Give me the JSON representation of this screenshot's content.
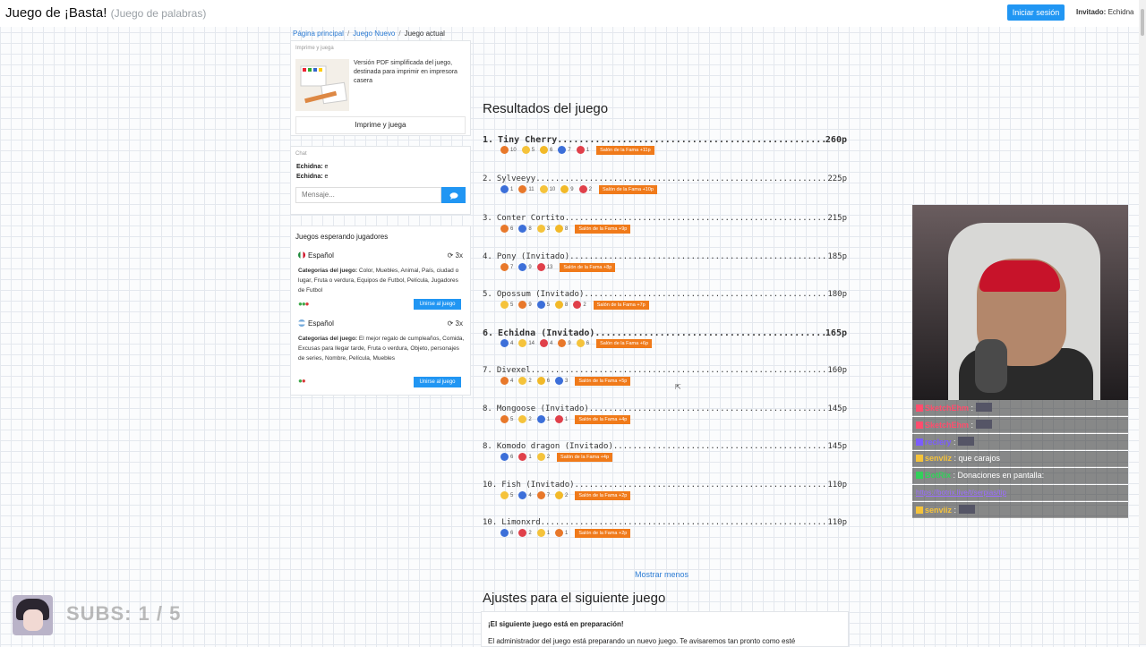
{
  "header": {
    "title": "Juego de ¡Basta!",
    "subtitle": "(Juego de palabras)",
    "login_label": "Iniciar sesión",
    "guest_label": "Invitado:",
    "guest_name": "Echidna"
  },
  "breadcrumb": {
    "home": "Página principal",
    "new_game": "Juego Nuevo",
    "current": "Juego actual"
  },
  "print": {
    "label": "Imprime y juega",
    "description": "Versión PDF simplificada del juego, destinada para imprimir en impresora casera",
    "button": "Imprime y juega"
  },
  "chat": {
    "label": "Chat",
    "messages": [
      {
        "user": "Echidna:",
        "text": "e"
      },
      {
        "user": "Echidna:",
        "text": "e"
      }
    ],
    "placeholder": "Mensaje..."
  },
  "waiting_games": {
    "title": "Juegos esperando jugadores",
    "games": [
      {
        "language": "Español",
        "multiplier": "3x",
        "cats_label": "Categorías del juego:",
        "cats": "Color, Muebles, Animal, País, ciudad o lugar, Fruta o verdura, Equipos de Futbol, Película, Jugadores de Futbol",
        "join": "Unirse al juego",
        "flag_color": "#2e8b3e"
      },
      {
        "language": "Español",
        "multiplier": "3x",
        "cats_label": "Categorías del juego:",
        "cats": "El mejor regalo de cumpleaños, Comida, Excusas para llegar tarde, Fruta o verdura, Objeto, personajes de series, Nombre, Película, Muebles",
        "join": "Unirse al juego",
        "flag_color": "#5aa0e0"
      }
    ]
  },
  "results": {
    "title": "Resultados del juego",
    "rows": [
      {
        "rank": "1.",
        "name": "Tiny Cherry",
        "points": "260p",
        "bold": true,
        "reactions": [
          {
            "type": "angry",
            "count": "10"
          },
          {
            "type": "laugh",
            "count": "5"
          },
          {
            "type": "wow",
            "count": "6"
          },
          {
            "type": "like",
            "count": "7"
          },
          {
            "type": "heart",
            "count": "1"
          }
        ],
        "fame": "Salón de la Fama +11p"
      },
      {
        "rank": "2.",
        "name": "Sylveeyy",
        "points": "225p",
        "bold": false,
        "reactions": [
          {
            "type": "like",
            "count": "1"
          },
          {
            "type": "angry",
            "count": "11"
          },
          {
            "type": "laugh",
            "count": "10"
          },
          {
            "type": "wow",
            "count": "9"
          },
          {
            "type": "heart",
            "count": "2"
          }
        ],
        "fame": "Salón de la Fama +10p"
      },
      {
        "rank": "3.",
        "name": "Conter Cortito",
        "points": "215p",
        "bold": false,
        "reactions": [
          {
            "type": "angry",
            "count": "6"
          },
          {
            "type": "like",
            "count": "8"
          },
          {
            "type": "laugh",
            "count": "3"
          },
          {
            "type": "wow",
            "count": "8"
          }
        ],
        "fame": "Salón de la Fama +9p"
      },
      {
        "rank": "4.",
        "name": "Pony (Invitado)",
        "points": "185p",
        "bold": false,
        "reactions": [
          {
            "type": "angry",
            "count": "7"
          },
          {
            "type": "like",
            "count": "9"
          },
          {
            "type": "heart",
            "count": "13"
          }
        ],
        "fame": "Salón de la Fama +8p"
      },
      {
        "rank": "5.",
        "name": "Opossum (Invitado)",
        "points": "180p",
        "bold": false,
        "reactions": [
          {
            "type": "laugh",
            "count": "5"
          },
          {
            "type": "angry",
            "count": "9"
          },
          {
            "type": "like",
            "count": "5"
          },
          {
            "type": "wow",
            "count": "8"
          },
          {
            "type": "heart",
            "count": "2"
          }
        ],
        "fame": "Salón de la Fama +7p"
      },
      {
        "rank": "6.",
        "name": "Echidna (Invitado)",
        "points": "165p",
        "bold": true,
        "reactions": [
          {
            "type": "like",
            "count": "4"
          },
          {
            "type": "laugh",
            "count": "14"
          },
          {
            "type": "heart",
            "count": "4"
          },
          {
            "type": "angry",
            "count": "9"
          },
          {
            "type": "laugh",
            "count": "6"
          }
        ],
        "fame": "Salón de la Fama +6p"
      },
      {
        "rank": "7.",
        "name": "Divexel",
        "points": "160p",
        "bold": false,
        "reactions": [
          {
            "type": "angry",
            "count": "4"
          },
          {
            "type": "laugh",
            "count": "2"
          },
          {
            "type": "wow",
            "count": "6"
          },
          {
            "type": "like",
            "count": "3"
          }
        ],
        "fame": "Salón de la Fama +5p"
      },
      {
        "rank": "8.",
        "name": "Mongoose (Invitado)",
        "points": "145p",
        "bold": false,
        "reactions": [
          {
            "type": "angry",
            "count": "5"
          },
          {
            "type": "laugh",
            "count": "2"
          },
          {
            "type": "like",
            "count": "1"
          },
          {
            "type": "heart",
            "count": "1"
          }
        ],
        "fame": "Salón de la Fama +4p"
      },
      {
        "rank": "8.",
        "name": "Komodo dragon (Invitado)",
        "points": "145p",
        "bold": false,
        "reactions": [
          {
            "type": "like",
            "count": "6"
          },
          {
            "type": "heart",
            "count": "1"
          },
          {
            "type": "laugh",
            "count": "2"
          }
        ],
        "fame": "Salón de la Fama +4p"
      },
      {
        "rank": "10.",
        "name": "Fish (Invitado)",
        "points": "110p",
        "bold": false,
        "reactions": [
          {
            "type": "laugh",
            "count": "5"
          },
          {
            "type": "like",
            "count": "4"
          },
          {
            "type": "angry",
            "count": "7"
          },
          {
            "type": "wow",
            "count": "2"
          }
        ],
        "fame": "Salón de la Fama +2p"
      },
      {
        "rank": "10.",
        "name": "Limonxrd",
        "points": "110p",
        "bold": false,
        "reactions": [
          {
            "type": "like",
            "count": "6"
          },
          {
            "type": "heart",
            "count": "2"
          },
          {
            "type": "laugh",
            "count": "1"
          },
          {
            "type": "angry",
            "count": "1"
          }
        ],
        "fame": "Salón de la Fama +2p"
      }
    ],
    "show_less": "Mostrar menos"
  },
  "settings": {
    "title": "Ajustes para el siguiente juego",
    "heading": "¡El siguiente juego está en preparación!",
    "body": "El administrador del juego está preparando un nuevo juego. Te avisaremos tan pronto como esté"
  },
  "stream_chat": {
    "lines": [
      {
        "user": "SketchEhm",
        "text": ""
      },
      {
        "user": "SketchEhm",
        "text": ""
      },
      {
        "user": "reclery",
        "text": ""
      },
      {
        "user": "senviiz",
        "text": "que carajos"
      },
      {
        "user": "BotRix",
        "text": "Donaciones en pantalla:"
      },
      {
        "user": "",
        "text": "",
        "link": "https://botrix.live/t/serpias/tip"
      },
      {
        "user": "senviiz",
        "text": ""
      }
    ],
    "user_colors": [
      "#ff4d6d",
      "#ff4d6d",
      "#7b5cff",
      "#f5c33b",
      "#32d05a",
      "#9b6cff",
      "#f5c33b"
    ]
  },
  "overlay": {
    "subs": "SUBS: 1 / 5"
  }
}
